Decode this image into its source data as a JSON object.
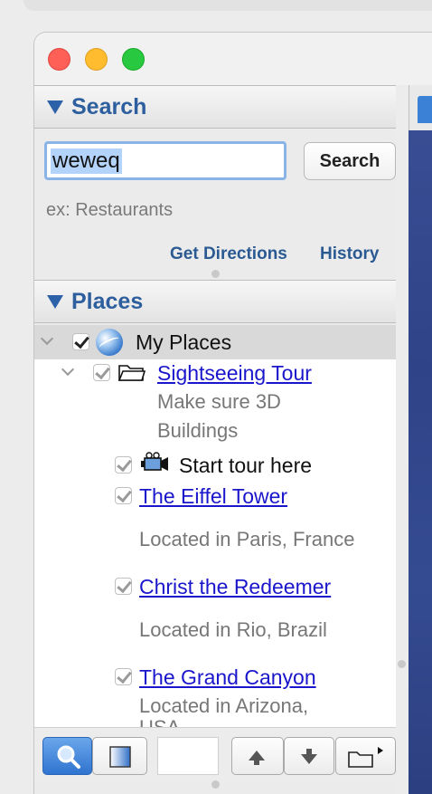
{
  "search": {
    "header": "Search",
    "query": "weweq",
    "button_label": "Search",
    "example": "ex: Restaurants",
    "get_directions": "Get Directions",
    "history": "History"
  },
  "places": {
    "header": "Places",
    "root_label": "My Places",
    "folder_label": "Sightseeing Tour",
    "folder_desc_1": "Make sure 3D",
    "folder_desc_2": "Buildings",
    "tour_label": "Start tour here",
    "items": [
      {
        "label": "The Eiffel Tower",
        "desc": "Located in Paris, France"
      },
      {
        "label": "Christ the Redeemer",
        "desc": "Located in Rio, Brazil"
      },
      {
        "label": "The Grand Canyon",
        "desc": "Located in Arizona,",
        "desc_cut": "USA"
      }
    ]
  },
  "colors": {
    "header_text": "#2d5e9e",
    "link": "#1a16cc",
    "selected_row": "#d9d9d9"
  },
  "icons": {
    "search_header": "triangle-down-icon",
    "places_header": "triangle-down-icon",
    "root": "globe-icon",
    "folder": "folder-icon",
    "tour": "tour-camera-icon"
  }
}
